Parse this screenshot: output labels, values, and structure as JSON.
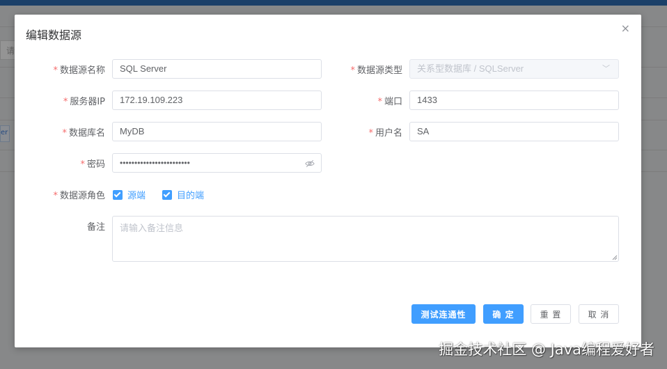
{
  "background": {
    "search_placeholder_fragment": "请",
    "chip_fragment": "er"
  },
  "dialog": {
    "title": "编辑数据源",
    "close_icon": "×"
  },
  "form": {
    "required_mark": "*",
    "name": {
      "label": "数据源名称",
      "value": "SQL Server"
    },
    "type": {
      "label": "数据源类型",
      "value": "关系型数据库 / SQLServer",
      "arrow": "﹀"
    },
    "server_ip": {
      "label": "服务器IP",
      "value": "172.19.109.223"
    },
    "port": {
      "label": "端口",
      "value": "1433"
    },
    "database": {
      "label": "数据库名",
      "value": "MyDB"
    },
    "username": {
      "label": "用户名",
      "value": "SA"
    },
    "password": {
      "label": "密码",
      "value": "••••••••••••••••••••••••"
    },
    "role": {
      "label": "数据源角色",
      "options": [
        {
          "label": "源端",
          "checked": true
        },
        {
          "label": "目的端",
          "checked": true
        }
      ]
    },
    "remark": {
      "label": "备注",
      "placeholder": "请输入备注信息"
    }
  },
  "buttons": {
    "test": "测试连通性",
    "confirm": "确 定",
    "reset": "重 置",
    "cancel": "取 消"
  },
  "watermark": "掘金技术社区 @ Java编程爱好者",
  "colors": {
    "primary": "#409eff",
    "required": "#f56c6c",
    "topbar": "#2f6fb5"
  }
}
